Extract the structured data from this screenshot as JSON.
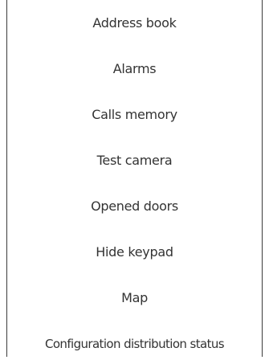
{
  "menu": {
    "items": [
      {
        "label": "Address book"
      },
      {
        "label": "Alarms"
      },
      {
        "label": "Calls memory"
      },
      {
        "label": "Test camera"
      },
      {
        "label": "Opened doors"
      },
      {
        "label": "Hide keypad"
      },
      {
        "label": "Map"
      },
      {
        "label": "Configuration distribution status"
      }
    ]
  }
}
